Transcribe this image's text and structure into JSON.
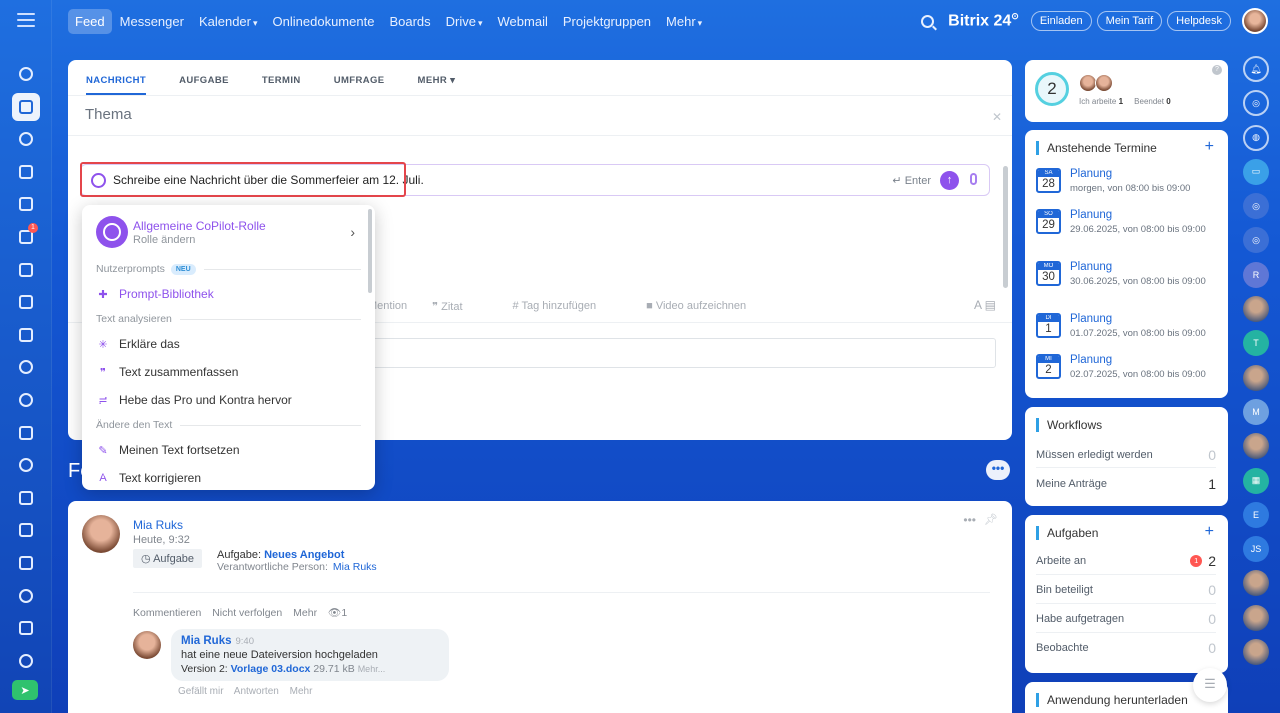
{
  "topbar": {
    "nav": [
      {
        "label": "Feed",
        "active": true,
        "caret": false
      },
      {
        "label": "Messenger",
        "active": false,
        "caret": false
      },
      {
        "label": "Kalender",
        "active": false,
        "caret": true
      },
      {
        "label": "Onlinedokumente",
        "active": false,
        "caret": false
      },
      {
        "label": "Boards",
        "active": false,
        "caret": false
      },
      {
        "label": "Drive",
        "active": false,
        "caret": true
      },
      {
        "label": "Webmail",
        "active": false,
        "caret": false
      },
      {
        "label": "Projektgruppen",
        "active": false,
        "caret": false
      },
      {
        "label": "Mehr",
        "active": false,
        "caret": true
      }
    ],
    "brand": "Bitrix 24",
    "buttons": {
      "invite": "Einladen",
      "plan": "Mein Tarif",
      "help": "Helpdesk"
    }
  },
  "rail": {
    "badge_count": "1"
  },
  "composer": {
    "tabs": [
      "NACHRICHT",
      "AUFGABE",
      "TERMIN",
      "UMFRAGE",
      "MEHR"
    ],
    "topic_placeholder": "Thema",
    "copilot_input": "Schreibe eine Nachricht über die Sommerfeier am 12. Juli.",
    "enter_hint": "Enter",
    "toolbar": [
      "Mention",
      "Zitat",
      "Tag hinzufügen",
      "Video aufzeichnen"
    ],
    "toolbar_font_glyph": "A"
  },
  "copilot_menu": {
    "role_name": "Allgemeine CoPilot-Rolle",
    "role_sub": "Rolle ändern",
    "section_prompts": "Nutzerprompts",
    "new_badge": "NEU",
    "prompt_library": "Prompt-Bibliothek",
    "section_analyze": "Text analysieren",
    "analyze_items": [
      "Erkläre das",
      "Text zusammenfassen",
      "Hebe das Pro und Kontra hervor"
    ],
    "section_change": "Ändere den Text",
    "change_items": [
      "Meinen Text fortsetzen",
      "Text korrigieren"
    ]
  },
  "feed": {
    "title": "Feed"
  },
  "post": {
    "author": "Mia Ruks",
    "time": "Heute, 9:32",
    "tag": "Aufgabe",
    "task_label": "Aufgabe:",
    "task_name": "Neues Angebot",
    "responsible_label": "Verantwortliche Person:",
    "responsible_name": "Mia Ruks",
    "actions": [
      "Kommentieren",
      "Nicht verfolgen",
      "Mehr"
    ],
    "views": "1",
    "comment": {
      "author": "Mia Ruks",
      "time": "9:40",
      "text": "hat eine neue Dateiversion hochgeladen",
      "version_label": "Version 2:",
      "file_name": "Vorlage 03.docx",
      "file_size": "29.71 kB",
      "more": "Mehr...",
      "actions": [
        "Gefällt mir",
        "Antworten",
        "Mehr"
      ]
    }
  },
  "sidebar": {
    "work": {
      "count": "2",
      "working_label": "Ich arbeite",
      "working_count": "1",
      "done_label": "Beendet",
      "done_count": "0"
    },
    "termine": {
      "title": "Anstehende Termine",
      "events": [
        {
          "weekday": "SA",
          "day": "28",
          "title": "Planung",
          "when": "morgen, von 08:00 bis 09:00"
        },
        {
          "weekday": "SO",
          "day": "29",
          "title": "Planung",
          "when": "29.06.2025, von 08:00 bis 09:00"
        },
        {
          "weekday": "MO",
          "day": "30",
          "title": "Planung",
          "when": "30.06.2025, von 08:00 bis 09:00"
        },
        {
          "weekday": "DI",
          "day": "1",
          "title": "Planung",
          "when": "01.07.2025, von 08:00 bis 09:00"
        },
        {
          "weekday": "MI",
          "day": "2",
          "title": "Planung",
          "when": "02.07.2025, von 08:00 bis 09:00"
        }
      ]
    },
    "workflows": {
      "title": "Workflows",
      "rows": [
        {
          "label": "Müssen erledigt werden",
          "value": "0"
        },
        {
          "label": "Meine Anträge",
          "value": "1"
        }
      ]
    },
    "tasks": {
      "title": "Aufgaben",
      "rows": [
        {
          "label": "Arbeite an",
          "value": "2",
          "badge": "1"
        },
        {
          "label": "Bin beteiligt",
          "value": "0"
        },
        {
          "label": "Habe aufgetragen",
          "value": "0"
        },
        {
          "label": "Beobachte",
          "value": "0"
        }
      ]
    },
    "app": {
      "title": "Anwendung herunterladen"
    }
  },
  "right_rail": {
    "initials": [
      "R",
      "T",
      "M",
      "E",
      "JS"
    ]
  }
}
